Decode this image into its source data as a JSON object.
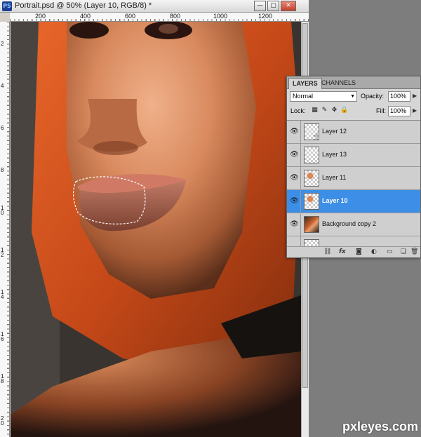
{
  "window": {
    "app_icon": "PS",
    "title": "Portrait.psd @ 50% (Layer 10, RGB/8) *",
    "controls": {
      "minimize": "—",
      "maximize": "▢",
      "close": "✕"
    }
  },
  "ruler_top_labels": [
    "200",
    "400",
    "600",
    "800",
    "1000",
    "1200"
  ],
  "ruler_left_labels": [
    "2",
    "4",
    "6",
    "8",
    "10",
    "12",
    "14",
    "16",
    "18",
    "20"
  ],
  "layers_panel": {
    "tabs": [
      "LAYERS",
      "CHANNELS"
    ],
    "blend_mode": "Normal",
    "opacity_label": "Opacity:",
    "opacity_value": "100%",
    "lock_label": "Lock:",
    "fill_label": "Fill:",
    "fill_value": "100%",
    "layers": [
      {
        "name": "Layer 12",
        "visible": true,
        "selected": false
      },
      {
        "name": "Layer 13",
        "visible": true,
        "selected": false
      },
      {
        "name": "Layer 11",
        "visible": true,
        "selected": false
      },
      {
        "name": "Layer 10",
        "visible": true,
        "selected": true
      },
      {
        "name": "Background copy 2",
        "visible": true,
        "selected": false
      },
      {
        "name": "",
        "visible": false,
        "selected": false
      }
    ]
  },
  "icons": {
    "eye": "eye-icon",
    "hand_cursor": "hand-cursor-icon",
    "link": "link-layers-icon",
    "fx": "fx-icon",
    "mask": "add-mask-icon",
    "adjustment": "adjustment-layer-icon",
    "group": "new-group-icon",
    "new_layer": "new-layer-icon",
    "trash": "trash-icon"
  },
  "watermark": "pxleyes.com"
}
